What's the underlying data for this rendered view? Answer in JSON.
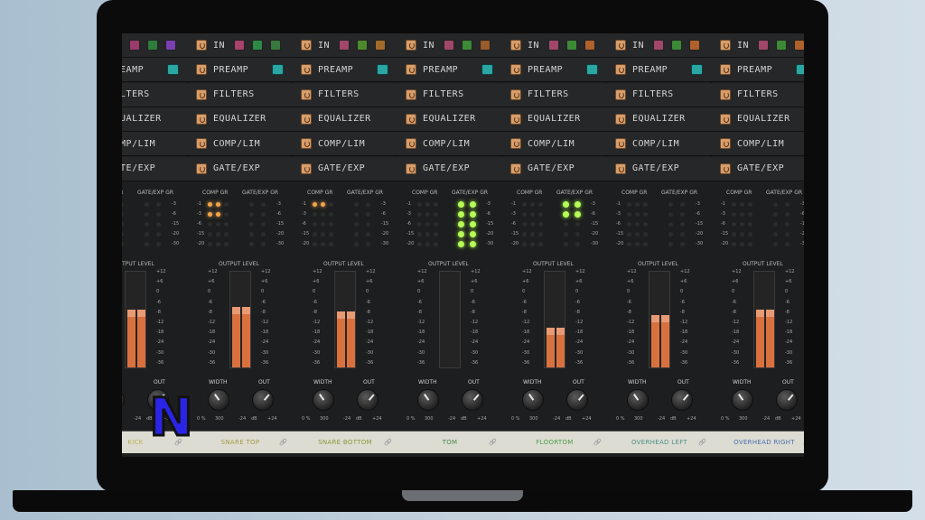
{
  "row_labels": {
    "in": "IN",
    "preamp": "PREAMP",
    "filters": "FILTERS",
    "equalizer": "EQUALIZER",
    "complim": "COMP/LIM",
    "gateexp": "GATE/EXP"
  },
  "meter_labels": {
    "comp_gr": "COMP GR",
    "gate_gr": "GATE/EXP GR",
    "output": "OUTPUT LEVEL",
    "width": "WIDTH",
    "out": "OUT",
    "width_min": "0 %",
    "width_max": "300",
    "out_min": "-24",
    "out_unit": "dB",
    "out_max": "+24"
  },
  "gr_scale": [
    "-1",
    "-3",
    "-6",
    "-15",
    "-20"
  ],
  "gate_scale": [
    "-3",
    "-6",
    "-15",
    "-20",
    "-30"
  ],
  "output_scale": [
    "+12",
    "+6",
    "0",
    "-6",
    "-8",
    "-12",
    "-18",
    "-24",
    "-30",
    "-36"
  ],
  "channels": [
    {
      "name": "KICK",
      "name_color": "#b9b056",
      "gr": [
        1,
        1,
        1,
        0,
        0
      ],
      "gate": [
        0,
        0,
        0,
        0,
        0
      ],
      "level": 0.62,
      "green": false,
      "partial": true
    },
    {
      "name": "SNARE TOP",
      "name_color": "#a89a46",
      "gr": [
        1,
        1,
        0,
        0,
        0
      ],
      "gate": [
        0,
        0,
        0,
        0,
        0
      ],
      "level": 0.64,
      "green": false
    },
    {
      "name": "SNARE BOTTOM",
      "name_color": "#8a9a3a",
      "gr": [
        1,
        0,
        0,
        0,
        0
      ],
      "gate": [
        0,
        0,
        0,
        0,
        0
      ],
      "level": 0.6,
      "green": false
    },
    {
      "name": "TOM",
      "name_color": "#4a8a48",
      "gr": [
        0,
        0,
        0,
        0,
        0
      ],
      "gate": [
        1,
        1,
        1,
        1,
        1
      ],
      "level": 0.0,
      "green": true
    },
    {
      "name": "FLOORTOM",
      "name_color": "#4f9c4a",
      "gr": [
        0,
        0,
        0,
        0,
        0
      ],
      "gate": [
        1,
        1,
        0,
        0,
        0
      ],
      "level": 0.42,
      "green": true
    },
    {
      "name": "OVERHEAD LEFT",
      "name_color": "#4f8f8a",
      "gr": [
        0,
        0,
        0,
        0,
        0
      ],
      "gate": [
        0,
        0,
        0,
        0,
        0
      ],
      "level": 0.56,
      "green": false
    },
    {
      "name": "OVERHEAD RIGHT",
      "name_color": "#4a6fb0",
      "gr": [
        0,
        0,
        0,
        0,
        0
      ],
      "gate": [
        0,
        0,
        0,
        0,
        0
      ],
      "level": 0.62,
      "green": false
    }
  ],
  "logo_letter": "N",
  "colors": {
    "power": "#d79e6b",
    "meter": "#d9713f",
    "led_orange": "#f3a54a",
    "led_green": "#b6ff57"
  }
}
